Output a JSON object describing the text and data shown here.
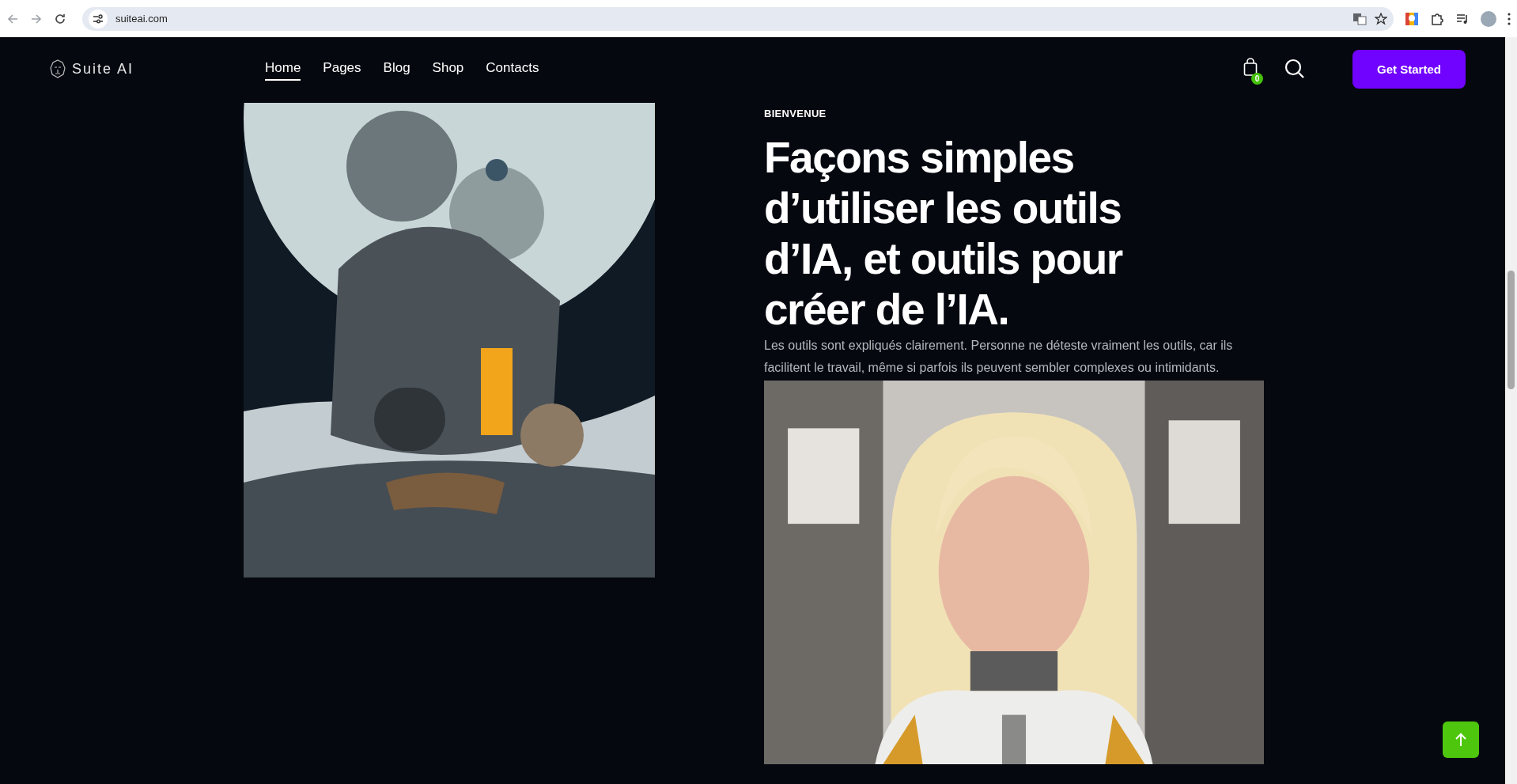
{
  "browser": {
    "url": "suiteai.com"
  },
  "header": {
    "logo": "Suite AI",
    "nav": [
      {
        "label": "Home",
        "selected": true
      },
      {
        "label": "Pages",
        "selected": false
      },
      {
        "label": "Blog",
        "selected": false
      },
      {
        "label": "Shop",
        "selected": false
      },
      {
        "label": "Contacts",
        "selected": false
      }
    ],
    "cart_count": "0",
    "cta": "Get Started"
  },
  "hero": {
    "eyebrow": "BIENVENUE",
    "heading": "Façons simples d’utiliser les outils d’IA, et outils pour créer de l’IA.",
    "body": "Les outils sont expliqués clairement. Personne ne déteste vraiment les outils, car ils facilitent le travail, même si parfois ils peuvent sembler complexes ou intimidants."
  }
}
